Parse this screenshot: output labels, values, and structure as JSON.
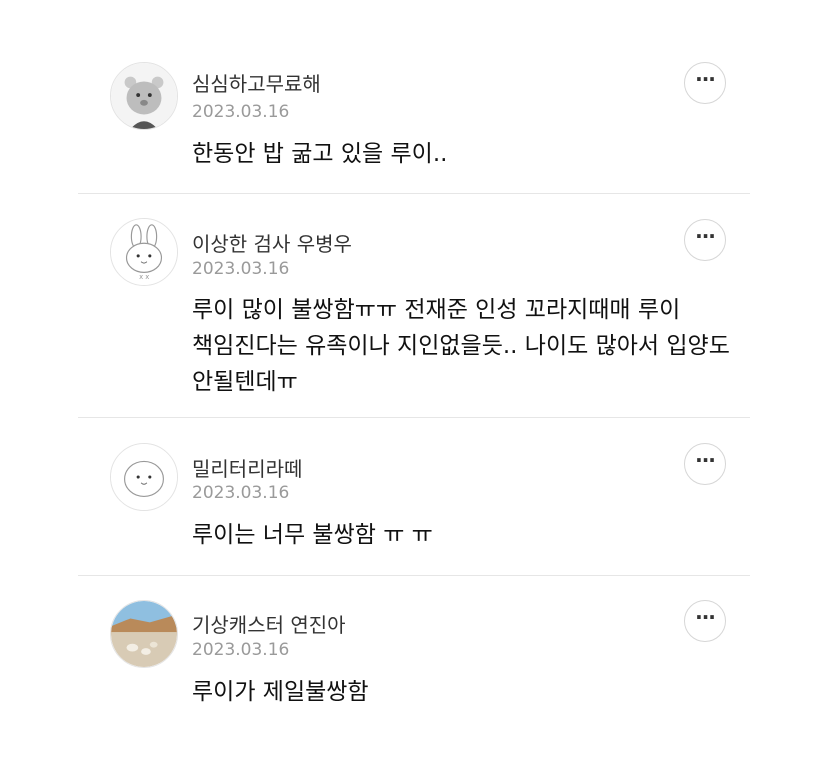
{
  "comments": [
    {
      "username": "심심하고무료해",
      "date": "2023.03.16",
      "text": "한동안 밥 굶고 있을 루이..",
      "avatar_icon": "bear-avatar-icon",
      "more_label": "···"
    },
    {
      "username": "이상한 검사 우병우",
      "date": "2023.03.16",
      "text": "루이 많이 불쌍함ㅠㅠ 전재준 인성 꼬라지때매 루이 책임진다는 유족이나 지인없을듯.. 나이도 많아서 입양도 안될텐데ㅠ",
      "avatar_icon": "rabbit-avatar-icon",
      "more_label": "···"
    },
    {
      "username": "밀리터리라떼",
      "date": "2023.03.16",
      "text": "루이는 너무 불쌍함 ㅠ ㅠ",
      "avatar_icon": "blob-avatar-icon",
      "more_label": "···"
    },
    {
      "username": "기상캐스터 연진아",
      "date": "2023.03.16",
      "text": "루이가 제일불쌍함",
      "avatar_icon": "beach-photo-avatar-icon",
      "more_label": "···"
    }
  ]
}
